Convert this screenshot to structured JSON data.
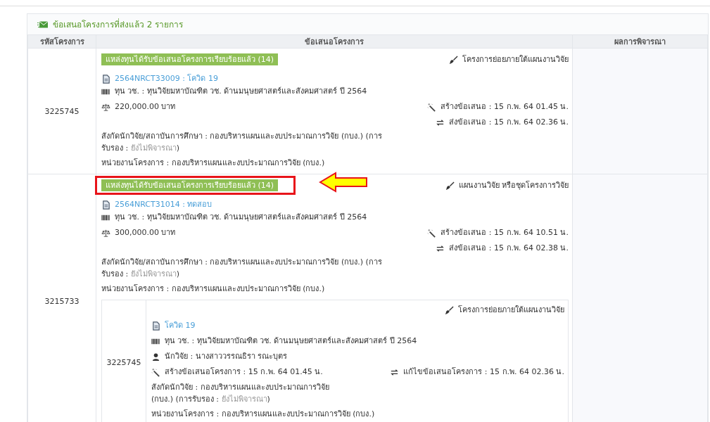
{
  "panel": {
    "title": "ข้อเสนอโครงการที่ส่งแล้ว 2 รายการ"
  },
  "table": {
    "columns": [
      "รหัสโครงการ",
      "ข้อเสนอโครงการ",
      "ผลการพิจารณา"
    ],
    "rows": [
      {
        "code": "3225745",
        "badge": "แหล่งทุนได้รับข้อเสนอโครงการเรียบร้อยแล้ว (14)",
        "badge_highlighted": false,
        "type": "โครงการย่อยภายใต้แผนงานวิจัย",
        "link": "2564NRCT33009 : โควิด 19",
        "fund": "ทุน วช. : ทุนวิจัยมหาบัณฑิต วช. ด้านมนุษยศาสตร์และสังคมศาสตร์ ปี 2564",
        "amount": "220,000.00 บาท",
        "created": "สร้างข้อเสนอ : 15 ก.พ. 64 01.45 น.",
        "sent": "ส่งข้อเสนอ : 15 ก.พ. 64 02.36 น.",
        "affiliation": {
          "text": "สังกัดนักวิจัย/สถาบันการศึกษา : กองบริหารแผนและงบประมาณการวิจัย (กบง.) (การรับรอง : ",
          "status": "ยังไม่พิจารณา",
          "close": ")"
        },
        "unit": "หน่วยงานโครงการ : กองบริหารแผนและงบประมาณการวิจัย (กบง.)"
      },
      {
        "code": "3215733",
        "badge": "แหล่งทุนได้รับข้อเสนอโครงการเรียบร้อยแล้ว (14)",
        "badge_highlighted": true,
        "type": "แผนงานวิจัย หรือชุดโครงการวิจัย",
        "link": "2564NRCT31014 : ทดสอบ",
        "fund": "ทุน วช. : ทุนวิจัยมหาบัณฑิต วช. ด้านมนุษยศาสตร์และสังคมศาสตร์ ปี 2564",
        "amount": "300,000.00 บาท",
        "created": "สร้างข้อเสนอ : 15 ก.พ. 64 10.51 น.",
        "sent": "ส่งข้อเสนอ : 15 ก.พ. 64 02.38 น.",
        "affiliation": {
          "text": "สังกัดนักวิจัย/สถาบันการศึกษา : กองบริหารแผนและงบประมาณการวิจัย (กบง.) (การรับรอง : ",
          "status": "ยังไม่พิจารณา",
          "close": ")"
        },
        "unit": "หน่วยงานโครงการ : กองบริหารแผนและงบประมาณการวิจัย (กบง.)",
        "sub_projects": [
          {
            "code": "3225745",
            "type": "โครงการย่อยภายใต้แผนงานวิจัย",
            "link": "โควิด 19",
            "fund": "ทุน วช. : ทุนวิจัยมหาบัณฑิต วช. ด้านมนุษยศาสตร์และสังคมศาสตร์ ปี 2564",
            "researcher": "นักวิจัย : นางสาววรรณธิรา รณะบุตร",
            "created": "สร้างข้อเสนอโครงการ : 15 ก.พ. 64 01.45 น.",
            "edited": "แก้ไขข้อเสนอโครงการ : 15 ก.พ. 64 02.36 น.",
            "affiliation": {
              "text": "สังกัดนักวิจัย : กองบริหารแผนและงบประมาณการวิจัย (กบง.) (การรับรอง : ",
              "status": "ยังไม่พิจารณา",
              "close": ")"
            },
            "unit": "หน่วยงานโครงการ : กองบริหารแผนและงบประมาณการวิจัย (กบง.)"
          }
        ]
      }
    ]
  }
}
